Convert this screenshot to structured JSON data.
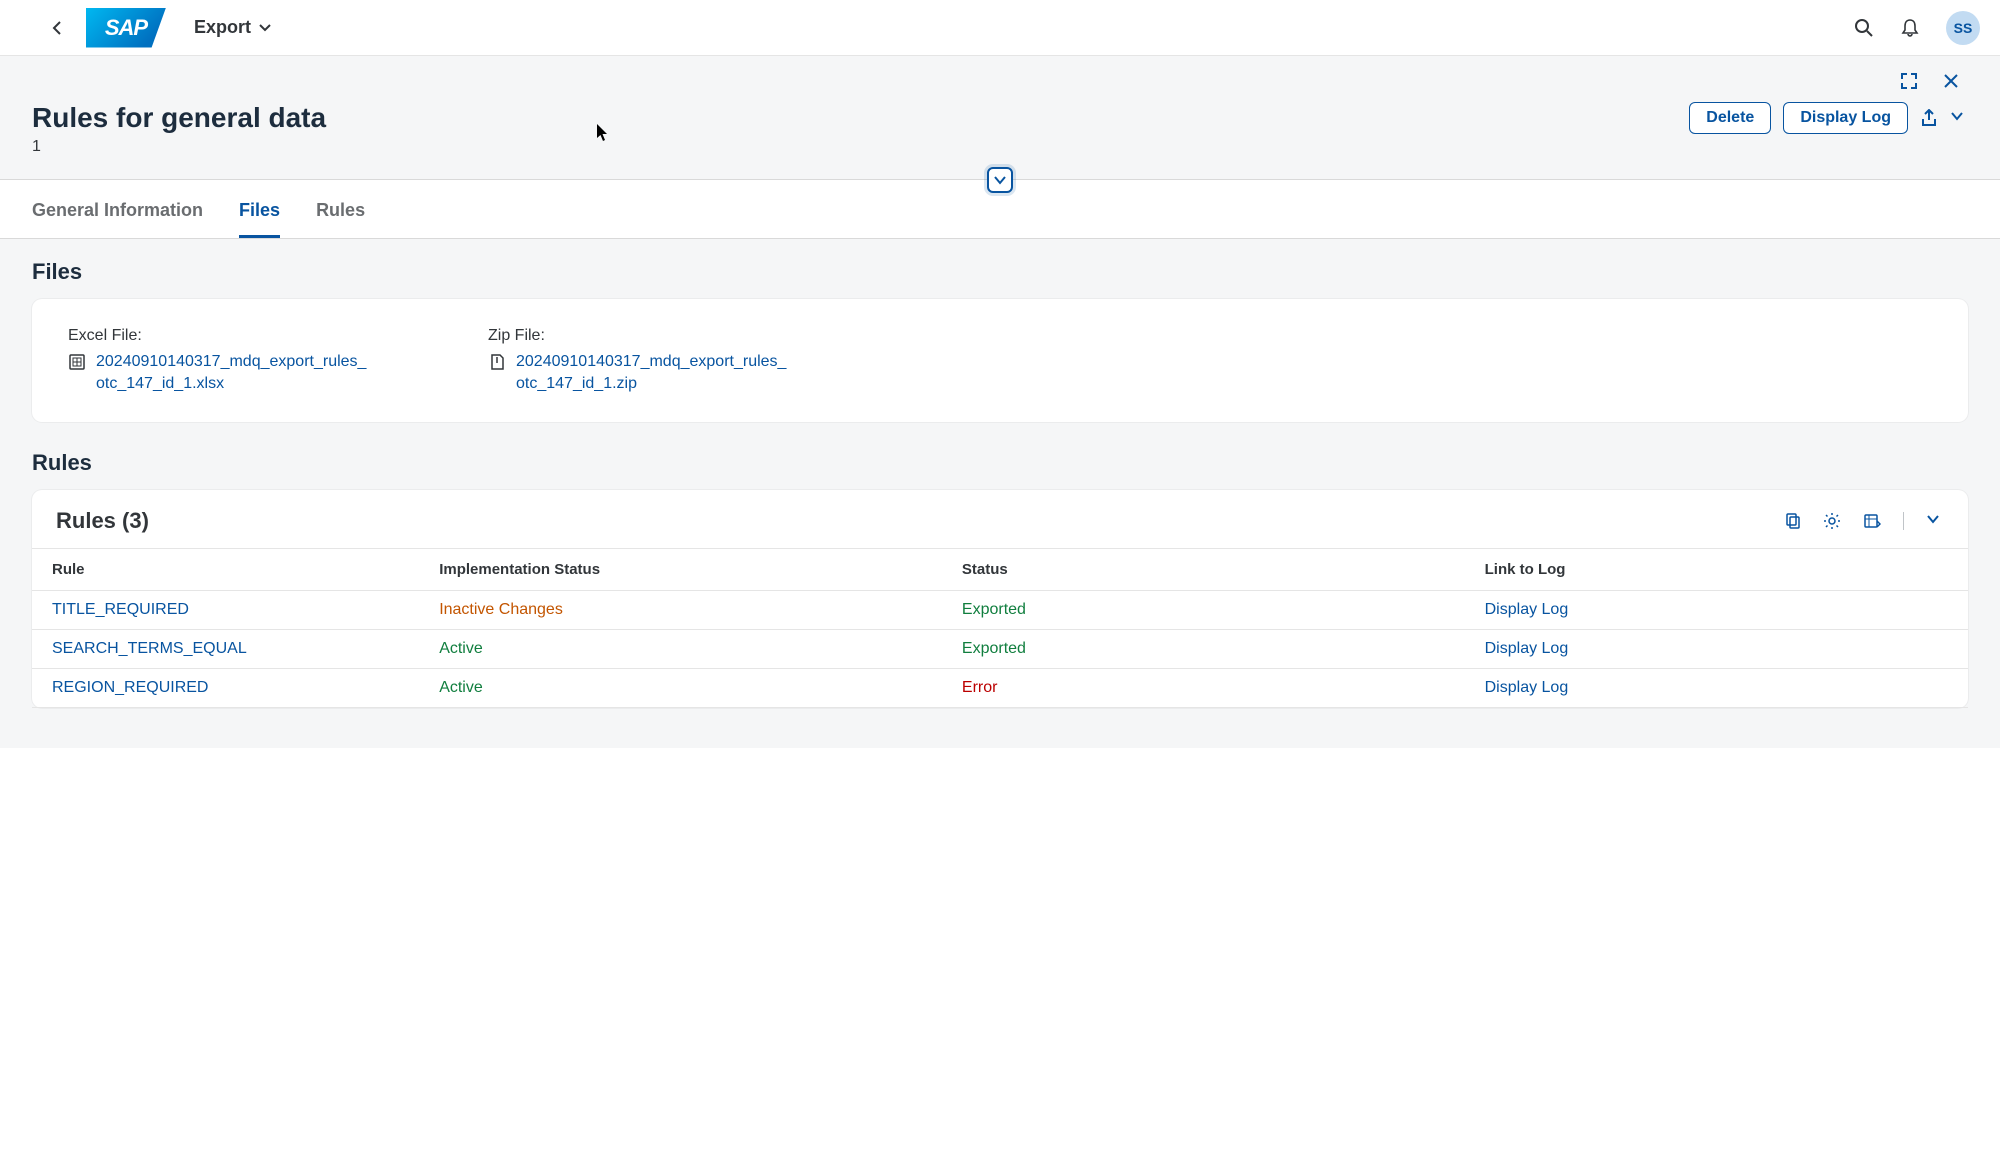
{
  "topbar": {
    "logo_text": "SAP",
    "export_label": "Export",
    "avatar_initials": "SS"
  },
  "page": {
    "title": "Rules for general data",
    "subtitle": "1",
    "actions": {
      "delete_label": "Delete",
      "display_log_label": "Display Log"
    }
  },
  "tabs": {
    "general_info": "General Information",
    "files": "Files",
    "rules": "Rules",
    "active": "files"
  },
  "files_section": {
    "heading": "Files",
    "excel": {
      "label": "Excel File:",
      "filename": "20240910140317_mdq_export_rules_otc_147_id_1.xlsx"
    },
    "zip": {
      "label": "Zip File:",
      "filename": "20240910140317_mdq_export_rules_otc_147_id_1.zip"
    }
  },
  "rules_section": {
    "heading": "Rules",
    "card_title": "Rules (3)",
    "columns": {
      "rule": "Rule",
      "impl_status": "Implementation Status",
      "status": "Status",
      "link_to_log": "Link to Log"
    },
    "rows": [
      {
        "rule": "TITLE_REQUIRED",
        "impl_status": "Inactive Changes",
        "impl_status_class": "status-orange",
        "status": "Exported",
        "status_class": "status-green",
        "link": "Display Log"
      },
      {
        "rule": "SEARCH_TERMS_EQUAL",
        "impl_status": "Active",
        "impl_status_class": "status-green",
        "status": "Exported",
        "status_class": "status-green",
        "link": "Display Log"
      },
      {
        "rule": "REGION_REQUIRED",
        "impl_status": "Active",
        "impl_status_class": "status-green",
        "status": "Error",
        "status_class": "status-red",
        "link": "Display Log"
      }
    ]
  }
}
